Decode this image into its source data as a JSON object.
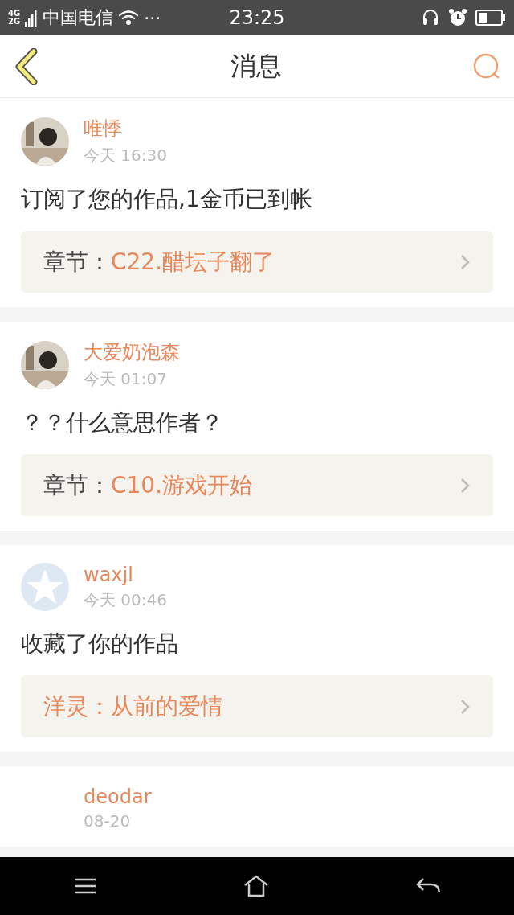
{
  "status_bar": {
    "network": "4G",
    "network_2": "2G",
    "carrier": "中国电信",
    "more": "···",
    "time": "23:25"
  },
  "header": {
    "title": "消息"
  },
  "messages": [
    {
      "name": "唯悸",
      "time": "今天 16:30",
      "text": "订阅了您的作品,1金币已到帐",
      "link": {
        "label": "章节：",
        "title": "C22.醋坛子翻了",
        "label_accent": false
      }
    },
    {
      "name": "大爱奶泡森",
      "time": "今天 01:07",
      "text": "？？什么意思作者？",
      "link": {
        "label": "章节：",
        "title": "C10.游戏开始",
        "label_accent": false
      }
    },
    {
      "avatar": {
        "kind": "default"
      },
      "name": "waxjl",
      "time": "今天 00:46",
      "text": "收藏了你的作品",
      "link": {
        "label": "洋灵：",
        "title": "从前的爱情",
        "label_accent": true
      }
    },
    {
      "name": "deodar",
      "time": "08-20"
    }
  ]
}
